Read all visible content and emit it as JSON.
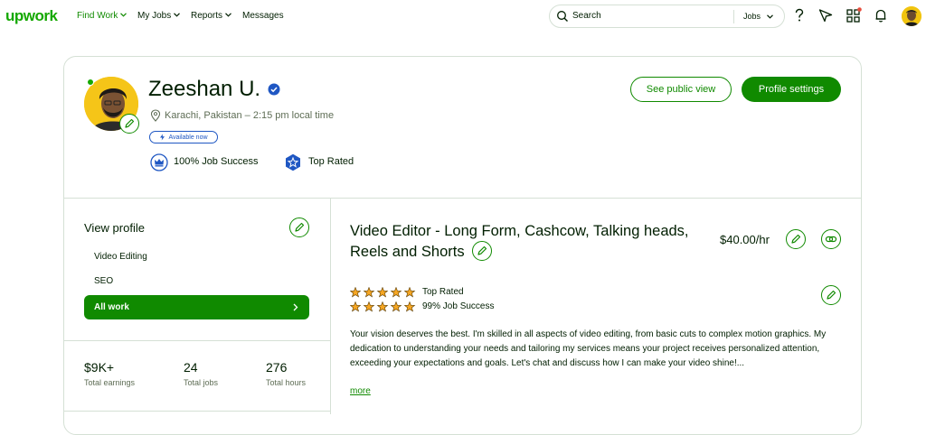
{
  "header": {
    "logo": "upwork",
    "nav": [
      {
        "label": "Find Work",
        "has_dropdown": true,
        "active": true
      },
      {
        "label": "My Jobs",
        "has_dropdown": true,
        "active": false
      },
      {
        "label": "Reports",
        "has_dropdown": true,
        "active": false
      },
      {
        "label": "Messages",
        "has_dropdown": false,
        "active": false
      }
    ],
    "search": {
      "placeholder": "Search",
      "scope": "Jobs"
    },
    "icons": [
      "help-icon",
      "direct-contracts-icon",
      "apps-icon",
      "notifications-icon",
      "user-avatar"
    ]
  },
  "profile": {
    "name": "Zeeshan U.",
    "location": "Karachi, Pakistan – 2:15 pm local time",
    "availability": "Available now",
    "badges": [
      {
        "label": "100% Job Success",
        "icon": "crown-icon"
      },
      {
        "label": "Top Rated",
        "icon": "top-rated-icon"
      }
    ],
    "see_public_view": "See public view",
    "profile_settings": "Profile settings"
  },
  "sidebar": {
    "title": "View profile",
    "items": [
      {
        "label": "Video Editing",
        "active": false
      },
      {
        "label": "SEO",
        "active": false
      },
      {
        "label": "All work",
        "active": true
      }
    ]
  },
  "stats": [
    {
      "value": "$9K+",
      "label": "Total earnings"
    },
    {
      "value": "24",
      "label": "Total jobs"
    },
    {
      "value": "276",
      "label": "Total hours"
    }
  ],
  "job": {
    "title": "Video Editor - Long Form, Cashcow, Talking heads, Reels and Shorts",
    "rate": "$40.00/hr",
    "ratings": [
      {
        "stars": 5,
        "label": "Top Rated"
      },
      {
        "stars": 5,
        "label": "99% Job Success"
      }
    ],
    "overview": "Your vision deserves the best. I'm skilled in all aspects of video editing, from basic cuts to complex motion graphics. My dedication to understanding your needs and tailoring my services means your project receives personalized attention, exceeding your expectations and goals. Let's chat and discuss how I can make your video shine!...",
    "more": "more"
  },
  "colors": {
    "brand_green": "#108a00",
    "logo_green": "#14a800",
    "verified_blue": "#1f57c3",
    "star": "#f5a623",
    "notification_dot": "#e74c3c"
  }
}
